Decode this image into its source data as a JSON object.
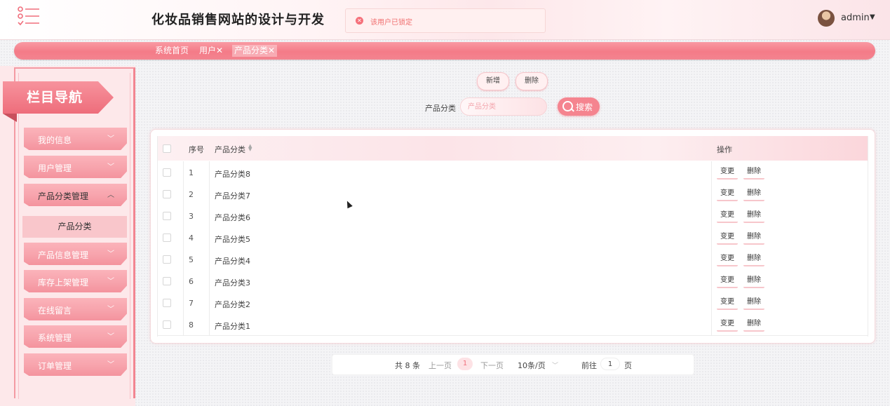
{
  "header": {
    "app_title": "化妆品销售网站的设计与开发",
    "alert_message": "该用户已锁定",
    "user_name": "admin",
    "user_caret": "▼"
  },
  "tabs": [
    {
      "label": "系统首页",
      "active": false
    },
    {
      "label": "用户✕",
      "active": false
    },
    {
      "label": "产品分类✕",
      "active": true
    }
  ],
  "sidebar": {
    "banner_title": "栏目导航",
    "items": [
      {
        "label": "我的信息",
        "expanded": false
      },
      {
        "label": "用户管理",
        "expanded": false
      },
      {
        "label": "产品分类管理",
        "expanded": true
      },
      {
        "label": "产品信息管理",
        "expanded": false
      },
      {
        "label": "库存上架管理",
        "expanded": false
      },
      {
        "label": "在线留言",
        "expanded": false
      },
      {
        "label": "系统管理",
        "expanded": false
      },
      {
        "label": "订单管理",
        "expanded": false
      }
    ],
    "active_subitem": "产品分类"
  },
  "toolbar": {
    "add_label": "新增",
    "delete_label": "删除",
    "search_field_label": "产品分类",
    "search_placeholder": "产品分类",
    "search_button_label": "搜索"
  },
  "table": {
    "columns": [
      "序号",
      "产品分类",
      "操作"
    ],
    "rows": [
      {
        "index": "1",
        "name": "产品分类8"
      },
      {
        "index": "2",
        "name": "产品分类7"
      },
      {
        "index": "3",
        "name": "产品分类6"
      },
      {
        "index": "4",
        "name": "产品分类5"
      },
      {
        "index": "5",
        "name": "产品分类4"
      },
      {
        "index": "6",
        "name": "产品分类3"
      },
      {
        "index": "7",
        "name": "产品分类2"
      },
      {
        "index": "8",
        "name": "产品分类1"
      }
    ],
    "edit_label": "变更",
    "delete_label": "删除"
  },
  "pagination": {
    "total_text": "共 8 条",
    "prev_label": "上一页",
    "current_page": "1",
    "next_label": "下一页",
    "page_size": "10条/页",
    "goto_prefix": "前往",
    "goto_value": "1",
    "goto_suffix": "页"
  },
  "colors": {
    "accent": "#f47b88",
    "accent_light": "#fde2e5"
  }
}
